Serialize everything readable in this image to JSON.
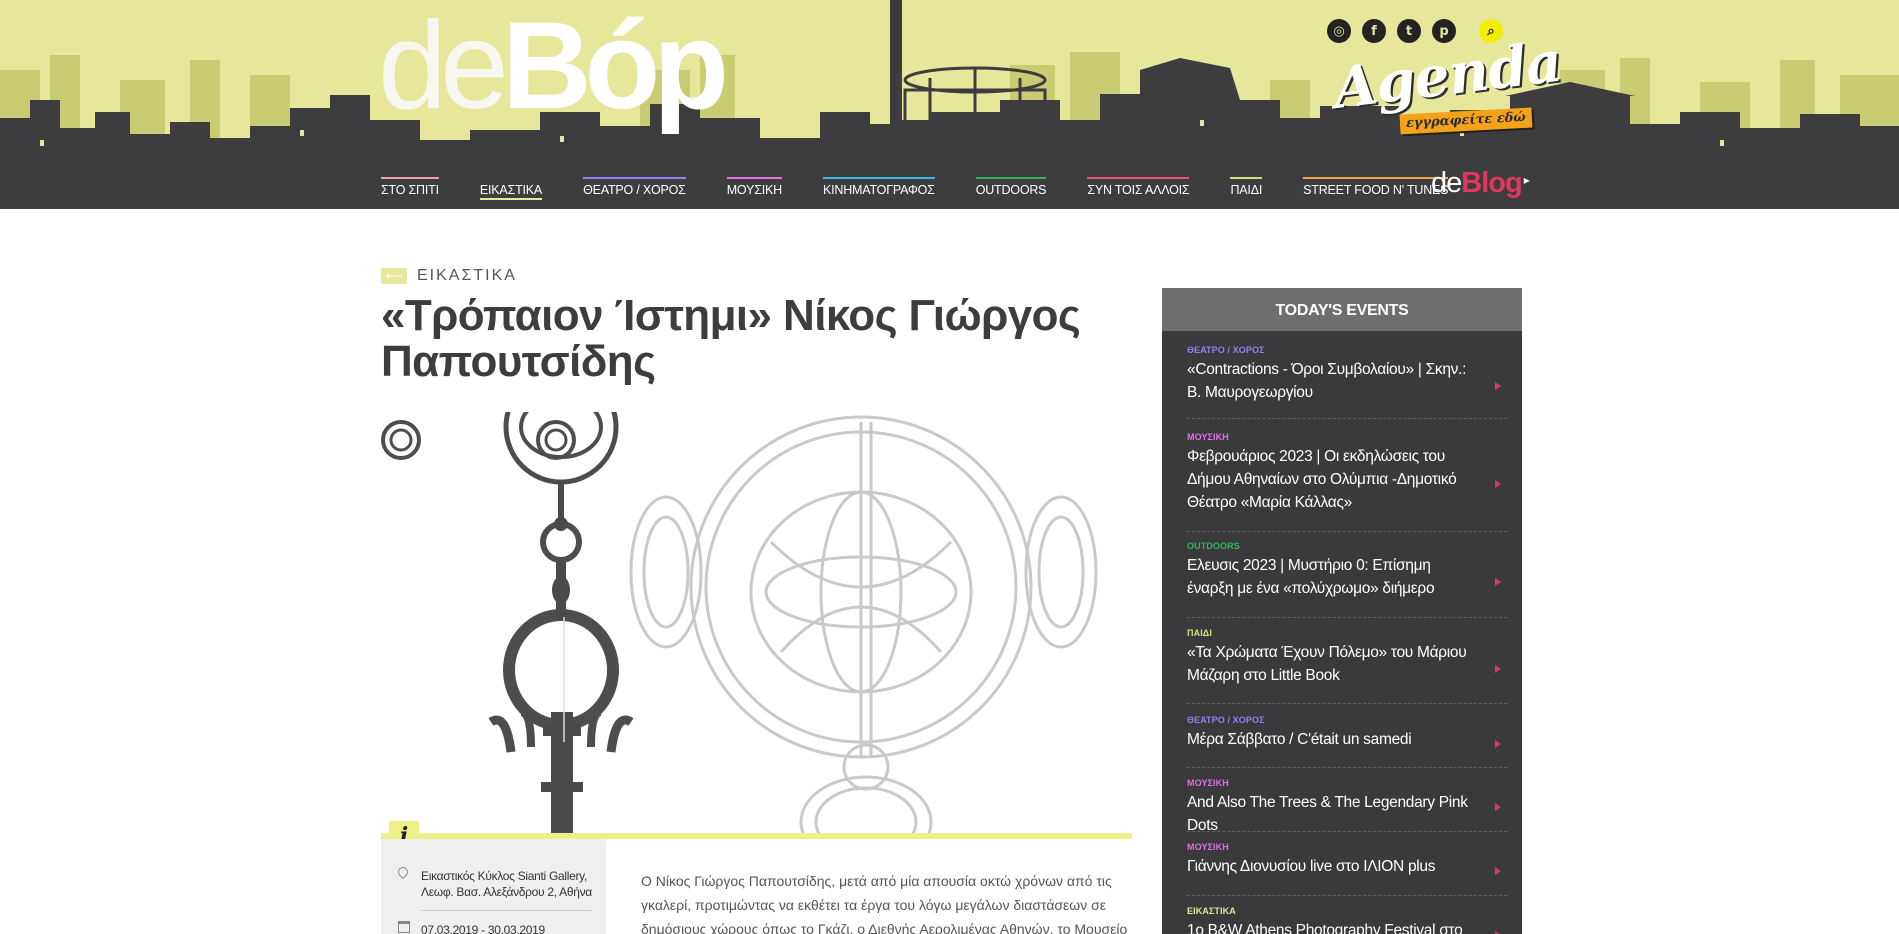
{
  "header": {
    "logo_de": "de",
    "logo_vor": "Bóp",
    "socials": [
      {
        "icon": "instagram-icon",
        "glyph": "◎"
      },
      {
        "icon": "facebook-icon",
        "glyph": "f"
      },
      {
        "icon": "twitter-icon",
        "glyph": "t"
      },
      {
        "icon": "pinterest-icon",
        "glyph": "p"
      }
    ],
    "search_glyph": "⌕",
    "agenda_title": "Agenda",
    "agenda_cta": "εγγραφείτε εδώ",
    "deblog_a": "de",
    "deblog_b": "Blog",
    "deblog_arrow": "▸",
    "colors": {
      "bg": "#e6e79a",
      "nav": "#3d3d3f",
      "accent": "#e0395d",
      "search": "#f2ee00"
    }
  },
  "nav": [
    {
      "label": "ΣΤΟ ΣΠΙΤΙ",
      "color": "#f2a3a8"
    },
    {
      "label": "ΕΙΚΑΣΤΙΚΑ",
      "color": "#e6e79a",
      "active": true
    },
    {
      "label": "ΘΕΑΤΡΟ / ΧΟΡΟΣ",
      "color": "#9b7cf0"
    },
    {
      "label": "ΜΟΥΣΙΚΗ",
      "color": "#e36fe3"
    },
    {
      "label": "ΚΙΝΗΜΑΤΟΓΡΑΦΟΣ",
      "color": "#38b6e6"
    },
    {
      "label": "OUTDOORS",
      "color": "#34b35e"
    },
    {
      "label": "ΣΥΝ ΤΟΙΣ ΑΛΛΟΙΣ",
      "color": "#e8537a"
    },
    {
      "label": "ΠΑΙΔΙ",
      "color": "#cfe27a"
    },
    {
      "label": "STREET FOOD N' TUNES",
      "color": "#f3a64a"
    }
  ],
  "article": {
    "category": "ΕΙΚΑΣΤΙΚΑ",
    "title": "«Τρόπαιον Ίστημι» Νίκος Γιώργος Παπουτσίδης",
    "info_badge": "i",
    "venue_line1": "Εικαστικός Κύκλος Sianti Gallery,",
    "venue_line2": "Λεωφ. Βασ. Αλεξάνδρου 2, Αθήνα",
    "dates": "07.03.2019 - 30.03.2019",
    "body_line1": "Ο Νίκος Γιώργος Παπουτσίδης, μετά από μία απουσία οκτώ χρόνων από τις",
    "body_line2": "γκαλερί, προτιμώντας να εκθέτει τα έργα του λόγω μεγάλων διαστάσεων σε",
    "body_line3": "δημόσιους χώρους όπως το Γκάζι, ο Διεθνής Αερολιμένας Αθηνών, το Μουσείο"
  },
  "sidebar": {
    "heading": "TODAY'S EVENTS",
    "items": [
      {
        "category": "ΘΕΑΤΡΟ / ΧΟΡΟΣ",
        "color": "#9b7cf0",
        "title": "«Contractions - Όροι Συμβολαίου» | Σκην.: Β. Μαυρογεωργίου"
      },
      {
        "category": "ΜΟΥΣΙΚΗ",
        "color": "#e36fe3",
        "title": "Φεβρουάριος 2023 | Οι εκδηλώσεις του Δήμου Αθηναίων στο Ολύμπια -Δημοτικό Θέατρο «Μαρία Κάλλας»"
      },
      {
        "category": "OUTDOORS",
        "color": "#34b35e",
        "title": "Ελευσις 2023 | Μυστήριο 0: Επίσημη έναρξη με ένα «πολύχρωμο» διήμερο"
      },
      {
        "category": "ΠΑΙΔΙ",
        "color": "#cfe27a",
        "title": "«Τα Χρώματα Έχουν Πόλεμο» του Μάριου Μάζαρη στο Little Book"
      },
      {
        "category": "ΘΕΑΤΡΟ / ΧΟΡΟΣ",
        "color": "#9b7cf0",
        "title": "Μέρα Σάββατο / C'était un samedi"
      },
      {
        "category": "ΜΟΥΣΙΚΗ",
        "color": "#e36fe3",
        "title": "And Also The Trees & The Legendary Pink Dots"
      },
      {
        "category": "ΜΟΥΣΙΚΗ",
        "color": "#e36fe3",
        "title": "Γιάννης Διονυσίου live στο ΙΛΙΟΝ plus"
      },
      {
        "category": "ΕΙΚΑΣΤΙΚΑ",
        "color": "#e6e79a",
        "title": "1ο B&W Athens Photography Festival στο"
      }
    ]
  }
}
